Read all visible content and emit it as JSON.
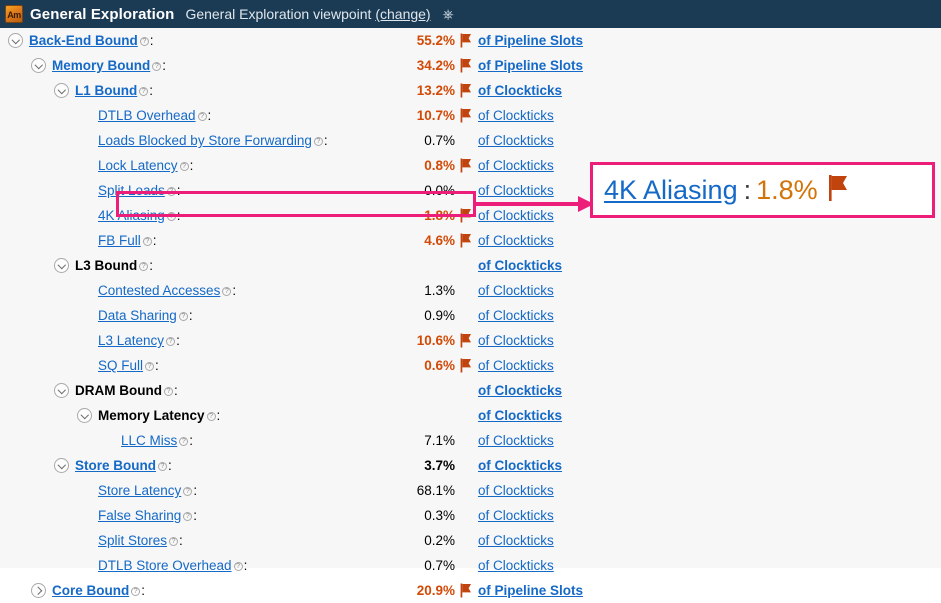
{
  "header": {
    "icon": "amplifier-icon",
    "icon_text": "Am",
    "title": "General Exploration",
    "subtitle": "General Exploration viewpoint",
    "change_label": "(change)",
    "help_icon": "?",
    "background": "#1b3a54"
  },
  "colors": {
    "link": "#1569c7",
    "hot_value": "#d24a06",
    "flag": "#c1440e",
    "annotation": "#ec1e79",
    "header_bg": "#1b3a54"
  },
  "rows": [
    {
      "indent": 0,
      "twisty": "expanded",
      "name": "Back-End Bound",
      "link": true,
      "bold": true,
      "value": "55.2%",
      "hot": true,
      "flag": true,
      "unit": "of Pipeline Slots",
      "unit_bold": true
    },
    {
      "indent": 1,
      "twisty": "expanded",
      "name": "Memory Bound",
      "link": true,
      "bold": true,
      "value": "34.2%",
      "hot": true,
      "flag": true,
      "unit": "of Pipeline Slots",
      "unit_bold": true
    },
    {
      "indent": 2,
      "twisty": "expanded",
      "name": "L1 Bound",
      "link": true,
      "bold": true,
      "value": "13.2%",
      "hot": true,
      "flag": true,
      "unit": "of Clockticks",
      "unit_bold": true
    },
    {
      "indent": 3,
      "twisty": "none",
      "name": "DTLB Overhead",
      "link": true,
      "bold": false,
      "value": "10.7%",
      "hot": true,
      "flag": true,
      "unit": "of Clockticks",
      "unit_bold": false
    },
    {
      "indent": 3,
      "twisty": "none",
      "name": "Loads Blocked by Store Forwarding",
      "link": true,
      "bold": false,
      "value": "0.7%",
      "hot": false,
      "flag": false,
      "unit": "of Clockticks",
      "unit_bold": false
    },
    {
      "indent": 3,
      "twisty": "none",
      "name": "Lock Latency",
      "link": true,
      "bold": false,
      "value": "0.8%",
      "hot": true,
      "flag": true,
      "unit": "of Clockticks",
      "unit_bold": false
    },
    {
      "indent": 3,
      "twisty": "none",
      "name": "Split Loads",
      "link": true,
      "bold": false,
      "value": "0.0%",
      "hot": false,
      "flag": false,
      "unit": "of Clockticks",
      "unit_bold": false
    },
    {
      "indent": 3,
      "twisty": "none",
      "name": "4K Aliasing",
      "link": true,
      "bold": false,
      "value": "1.8%",
      "hot": true,
      "flag": true,
      "unit": "of Clockticks",
      "unit_bold": false,
      "highlighted": true
    },
    {
      "indent": 3,
      "twisty": "none",
      "name": "FB Full",
      "link": true,
      "bold": false,
      "value": "4.6%",
      "hot": true,
      "flag": true,
      "unit": "of Clockticks",
      "unit_bold": false
    },
    {
      "indent": 2,
      "twisty": "expanded",
      "name": "L3 Bound",
      "link": false,
      "bold": true,
      "value": "",
      "hot": false,
      "flag": false,
      "unit": "of Clockticks",
      "unit_bold": true
    },
    {
      "indent": 3,
      "twisty": "none",
      "name": "Contested Accesses",
      "link": true,
      "bold": false,
      "value": "1.3%",
      "hot": false,
      "flag": false,
      "unit": "of Clockticks",
      "unit_bold": false
    },
    {
      "indent": 3,
      "twisty": "none",
      "name": "Data Sharing",
      "link": true,
      "bold": false,
      "value": "0.9%",
      "hot": false,
      "flag": false,
      "unit": "of Clockticks",
      "unit_bold": false
    },
    {
      "indent": 3,
      "twisty": "none",
      "name": "L3 Latency",
      "link": true,
      "bold": false,
      "value": "10.6%",
      "hot": true,
      "flag": true,
      "unit": "of Clockticks",
      "unit_bold": false
    },
    {
      "indent": 3,
      "twisty": "none",
      "name": "SQ Full",
      "link": true,
      "bold": false,
      "value": "0.6%",
      "hot": true,
      "flag": true,
      "unit": "of Clockticks",
      "unit_bold": false
    },
    {
      "indent": 2,
      "twisty": "expanded",
      "name": "DRAM Bound",
      "link": false,
      "bold": true,
      "value": "",
      "hot": false,
      "flag": false,
      "unit": "of Clockticks",
      "unit_bold": true
    },
    {
      "indent": 3,
      "twisty": "expanded",
      "name": "Memory Latency",
      "link": false,
      "bold": true,
      "value": "",
      "hot": false,
      "flag": false,
      "unit": "of Clockticks",
      "unit_bold": true
    },
    {
      "indent": 4,
      "twisty": "none",
      "name": "LLC Miss",
      "link": true,
      "bold": false,
      "value": "7.1%",
      "hot": false,
      "flag": false,
      "unit": "of Clockticks",
      "unit_bold": false
    },
    {
      "indent": 2,
      "twisty": "expanded",
      "name": "Store Bound",
      "link": true,
      "bold": true,
      "value": "3.7%",
      "hot": false,
      "flag": false,
      "unit": "of Clockticks",
      "unit_bold": true,
      "value_bold": true
    },
    {
      "indent": 3,
      "twisty": "none",
      "name": "Store Latency",
      "link": true,
      "bold": false,
      "value": "68.1%",
      "hot": false,
      "flag": false,
      "unit": "of Clockticks",
      "unit_bold": false
    },
    {
      "indent": 3,
      "twisty": "none",
      "name": "False Sharing",
      "link": true,
      "bold": false,
      "value": "0.3%",
      "hot": false,
      "flag": false,
      "unit": "of Clockticks",
      "unit_bold": false
    },
    {
      "indent": 3,
      "twisty": "none",
      "name": "Split Stores",
      "link": true,
      "bold": false,
      "value": "0.2%",
      "hot": false,
      "flag": false,
      "unit": "of Clockticks",
      "unit_bold": false
    },
    {
      "indent": 3,
      "twisty": "none",
      "name": "DTLB Store Overhead",
      "link": true,
      "bold": false,
      "value": "0.7%",
      "hot": false,
      "flag": false,
      "unit": "of Clockticks",
      "unit_bold": false
    },
    {
      "indent": 1,
      "twisty": "collapsed",
      "name": "Core Bound",
      "link": true,
      "bold": true,
      "value": "20.9%",
      "hot": true,
      "flag": true,
      "unit": "of Pipeline Slots",
      "unit_bold": true
    }
  ],
  "annotation": {
    "callout_name": "4K Aliasing",
    "callout_separator": ":",
    "callout_value": "1.8%",
    "callout_flag": "flag-icon"
  }
}
